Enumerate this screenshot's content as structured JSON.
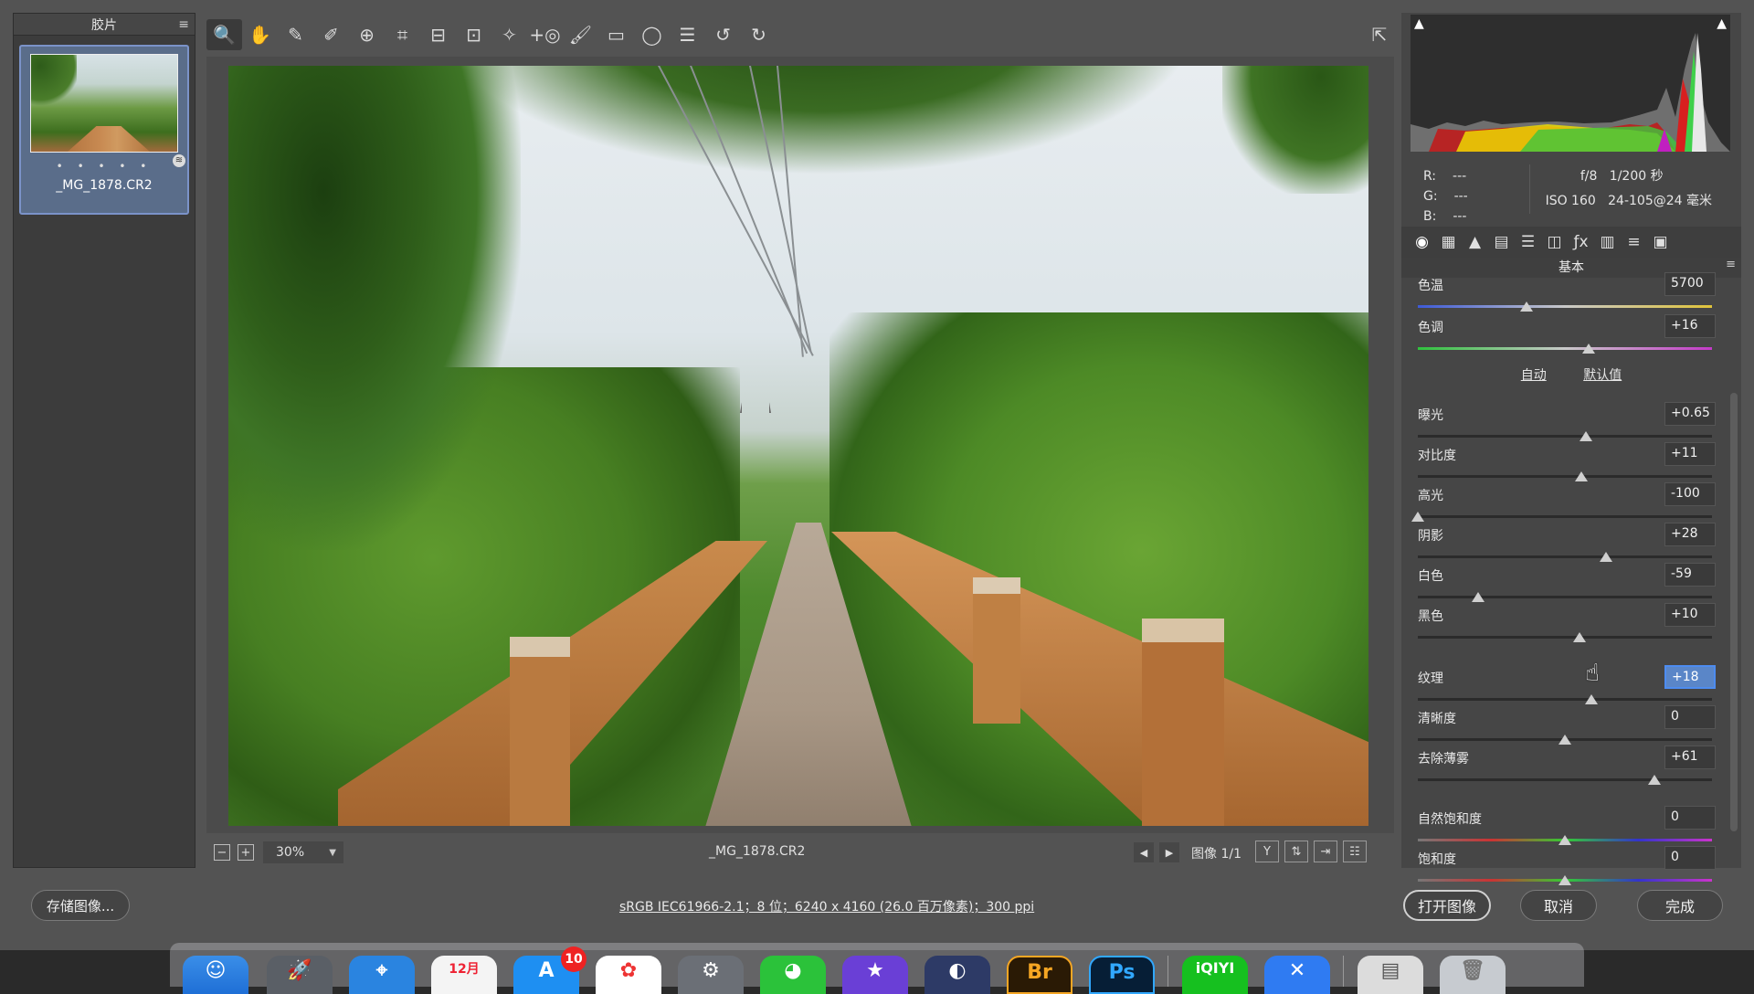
{
  "filmstrip": {
    "title": "胶片",
    "menu_icon": "hamburger-icon",
    "dots": "• • • • •",
    "filename": "_MG_1878.CR2"
  },
  "toolbar": {
    "tools": [
      "zoom-tool-icon",
      "hand-tool-icon",
      "white-balance-icon",
      "color-sampler-icon",
      "targeted-adjust-icon",
      "crop-icon",
      "straighten-icon",
      "transform-icon",
      "spot-removal-icon",
      "red-eye-icon",
      "adjustment-brush-icon",
      "graduated-filter-icon",
      "radial-filter-icon",
      "presets-list-icon",
      "rotate-left-icon",
      "rotate-right-icon"
    ],
    "toggle_fullscreen": "toggle-fullscreen-icon"
  },
  "preview_footer": {
    "zoom": "30%",
    "filename": "_MG_1878.CR2",
    "image_count": "图像 1/1"
  },
  "exif": {
    "r_label": "R:",
    "g_label": "G:",
    "b_label": "B:",
    "r": "---",
    "g": "---",
    "b": "---",
    "aperture": "f/8",
    "shutter": "1/200 秒",
    "iso": "ISO 160",
    "lens": "24-105@24 毫米"
  },
  "panel": {
    "section_title": "基本",
    "auto": "自动",
    "default": "默认值",
    "sliders": [
      {
        "label": "色温",
        "value": "5700",
        "pos": 0.37
      },
      {
        "label": "色调",
        "value": "+16",
        "pos": 0.58
      },
      {
        "label": "曝光",
        "value": "+0.65",
        "pos": 0.57
      },
      {
        "label": "对比度",
        "value": "+11",
        "pos": 0.555
      },
      {
        "label": "高光",
        "value": "-100",
        "pos": 0.0
      },
      {
        "label": "阴影",
        "value": "+28",
        "pos": 0.64
      },
      {
        "label": "白色",
        "value": "-59",
        "pos": 0.205
      },
      {
        "label": "黑色",
        "value": "+10",
        "pos": 0.55
      },
      {
        "label": "纹理",
        "value": "+18",
        "pos": 0.59
      },
      {
        "label": "清晰度",
        "value": "0",
        "pos": 0.5
      },
      {
        "label": "去除薄雾",
        "value": "+61",
        "pos": 0.805
      },
      {
        "label": "自然饱和度",
        "value": "0",
        "pos": 0.5
      },
      {
        "label": "饱和度",
        "value": "0",
        "pos": 0.5
      }
    ]
  },
  "bottom": {
    "save": "存储图像...",
    "info": "sRGB IEC61966-2.1；8 位；6240 x 4160 (26.0 百万像素)；300 ppi",
    "open": "打开图像",
    "cancel": "取消",
    "done": "完成"
  },
  "dock": {
    "items": [
      "finder-icon",
      "launchpad-icon",
      "safari-icon",
      "calendar-icon",
      "app-store-icon",
      "photos-icon",
      "system-preferences-icon",
      "wechat-icon",
      "imovie-icon",
      "quicktime-icon",
      "bridge-icon",
      "photoshop-icon",
      "iqiyi-icon",
      "xmind-icon",
      "preview-icon",
      "trash-icon"
    ],
    "calendar_month": "12月",
    "appstore_badge": "10",
    "bridge_label": "Br",
    "photoshop_label": "Ps",
    "iqiyi_label": "iQIYI"
  }
}
